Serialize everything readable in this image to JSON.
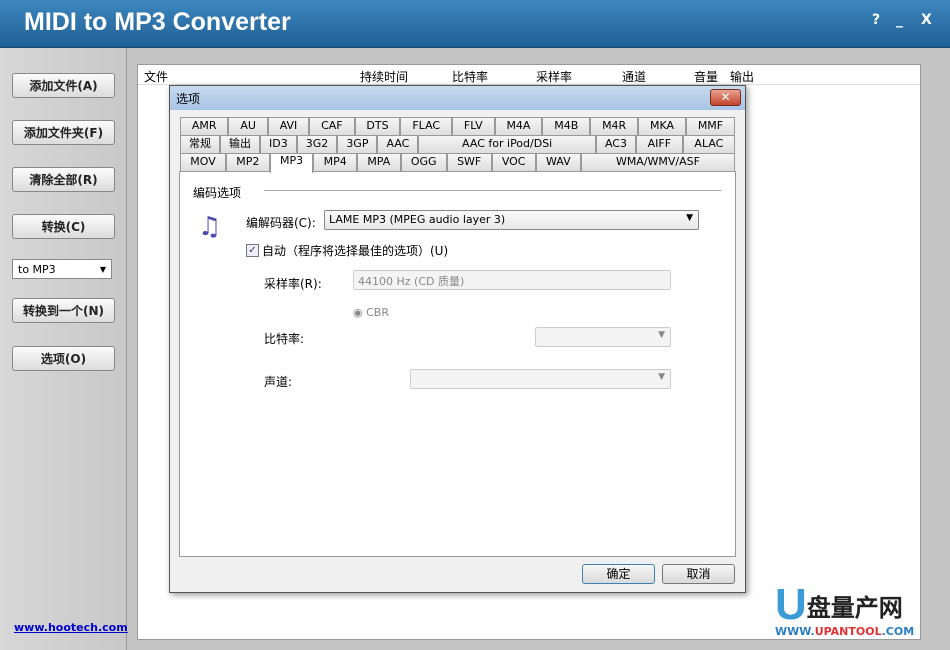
{
  "app": {
    "title": "MIDI to MP3 Converter",
    "help": "?",
    "minimize": "_",
    "close": "X"
  },
  "sidebar": {
    "buttons": [
      "添加文件(A)",
      "添加文件夹(F)",
      "清除全部(R)",
      "转换(C)",
      "转换到一个(N)",
      "选项(O)"
    ],
    "format_select": "to MP3",
    "link": "www.hootech.com"
  },
  "list": {
    "columns": [
      "文件",
      "持续时间",
      "比特率",
      "采样率",
      "通道",
      "音量",
      "输出"
    ]
  },
  "dialog": {
    "title": "选项",
    "close": "✕",
    "tabs": [
      [
        "AMR",
        "AU",
        "AVI",
        "CAF",
        "DTS",
        "FLAC",
        "FLV",
        "M4A",
        "M4B",
        "M4R",
        "MKA",
        "MMF"
      ],
      [
        "常规",
        "输出",
        "ID3",
        "3G2",
        "3GP",
        "AAC",
        "AAC for iPod/DSi",
        "AC3",
        "AIFF",
        "ALAC"
      ],
      [
        "MOV",
        "MP2",
        "MP3",
        "MP4",
        "MPA",
        "OGG",
        "SWF",
        "VOC",
        "WAV",
        "WMA/WMV/ASF"
      ]
    ],
    "active_tab": "MP3",
    "group": "编码选项",
    "codec_label": "编解码器(C):",
    "codec_value": "LAME MP3 (MPEG audio layer 3)",
    "auto_label": "自动（程序将选择最佳的选项）(U)",
    "auto_checked": true,
    "samplerate_label": "采样率(R):",
    "samplerate_value": "44100 Hz (CD 质量)",
    "cbr_label": "CBR",
    "bitrate_label": "比特率:",
    "channel_label": "声道:",
    "ok": "确定",
    "cancel": "取消"
  },
  "watermark": {
    "text": "U盘量产网",
    "url": "WWW.UPANTOOL.COM"
  }
}
